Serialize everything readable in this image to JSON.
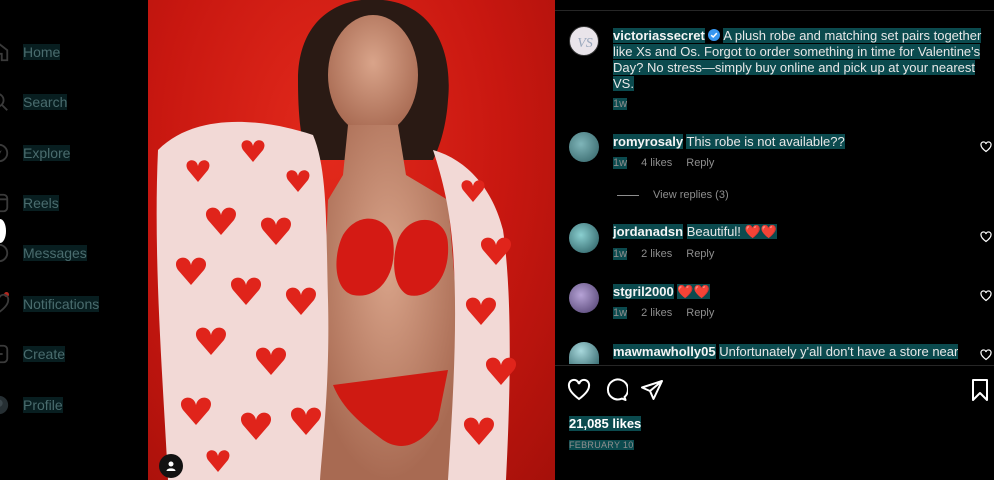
{
  "sidebar": {
    "items": [
      {
        "label": "Home",
        "icon": "home-icon"
      },
      {
        "label": "Search",
        "icon": "search-icon"
      },
      {
        "label": "Explore",
        "icon": "compass-icon"
      },
      {
        "label": "Reels",
        "icon": "reels-icon"
      },
      {
        "label": "Messages",
        "icon": "messenger-icon"
      },
      {
        "label": "Notifications",
        "icon": "heart-icon"
      },
      {
        "label": "Create",
        "icon": "plus-square-icon"
      },
      {
        "label": "Profile",
        "icon": "profile-avatar-icon"
      }
    ]
  },
  "post": {
    "author": "victoriassecret",
    "caption": "A plush robe and matching set pairs together like Xs and Os. Forgot to order something in time for Valentine's Day? No stress—simply buy online and pick up at your nearest VS.",
    "caption_age": "1w",
    "likes": "21,085 likes",
    "date": "FEBRUARY 10"
  },
  "comments": [
    {
      "user": "romyrosaly",
      "text": "This robe is not available??",
      "age": "1w",
      "likes": "4 likes",
      "reply": "Reply",
      "view_replies": "View replies (3)"
    },
    {
      "user": "jordanadsn",
      "text": "Beautiful! ❤️❤️",
      "age": "1w",
      "likes": "2 likes",
      "reply": "Reply"
    },
    {
      "user": "stgril2000",
      "text": "❤️❤️",
      "age": "1w",
      "likes": "2 likes",
      "reply": "Reply"
    },
    {
      "user": "mawmawholly05",
      "text": "Unfortunately y'all don't have a store near"
    }
  ],
  "colors": {
    "accent_red": "#e0241b",
    "highlight": "#0b4a4e",
    "muted": "#8e8e8e"
  }
}
